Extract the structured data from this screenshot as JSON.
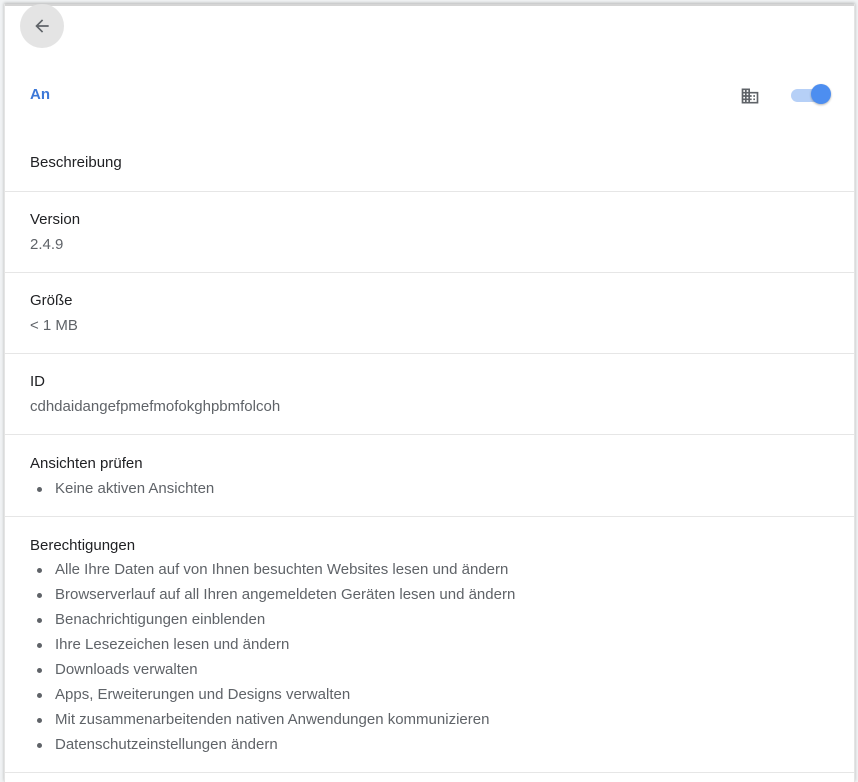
{
  "header": {
    "back_icon": "arrow-left-icon",
    "enabled_label": "An",
    "policy_icon": "domain-icon",
    "toggle_on": true,
    "accent_color": "#4d8ef0"
  },
  "details": {
    "description_label": "Beschreibung",
    "version_label": "Version",
    "version_value": "2.4.9",
    "size_label": "Größe",
    "size_value": "< 1 MB",
    "id_label": "ID",
    "id_value": "cdhdaidangefpmefmofokghpbmfolcoh",
    "views_label": "Ansichten prüfen",
    "views": [
      "Keine aktiven Ansichten"
    ],
    "permissions_label": "Berechtigungen",
    "permissions": [
      "Alle Ihre Daten auf von Ihnen besuchten Websites lesen und ändern",
      "Browserverlauf auf all Ihren angemeldeten Geräten lesen und ändern",
      "Benachrichtigungen einblenden",
      "Ihre Lesezeichen lesen und ändern",
      "Downloads verwalten",
      "Apps, Erweiterungen und Designs verwalten",
      "Mit zusammenarbeitenden nativen Anwendungen kommunizieren",
      "Datenschutzeinstellungen ändern"
    ]
  }
}
